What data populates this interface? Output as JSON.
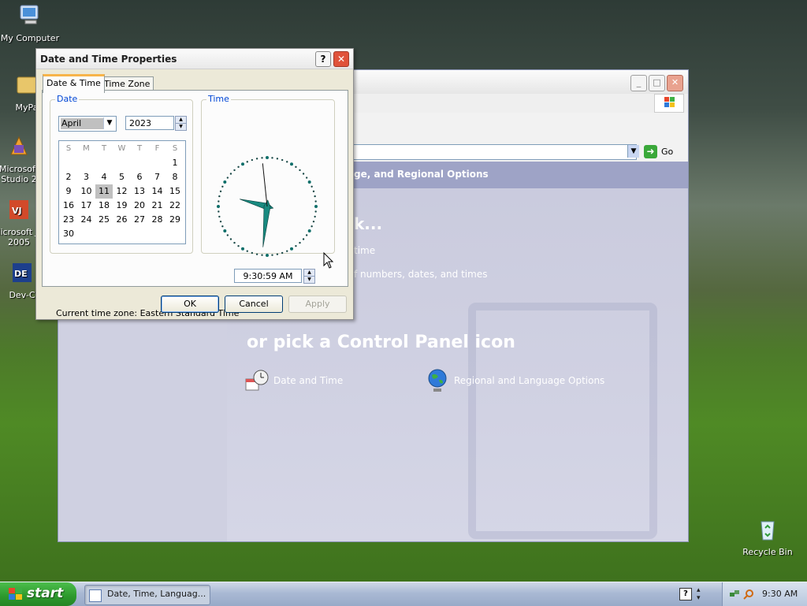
{
  "desktop": {
    "icons": [
      {
        "label": "My Computer"
      },
      {
        "label": "MyPa"
      },
      {
        "label": "Microsoft Studio 2"
      },
      {
        "label": "Microsoft J# 2005"
      },
      {
        "label": "Dev-C"
      },
      {
        "label": "Recycle Bin"
      }
    ]
  },
  "control_panel": {
    "go_label": "Go",
    "header": "ge, and Regional Options",
    "pick_task": "k...",
    "task1": "time",
    "task2": "f numbers, dates, and times",
    "pick_icon": "or pick a Control Panel icon",
    "icon_date_time": "Date and Time",
    "icon_regional": "Regional and Language Options"
  },
  "dialog": {
    "title": "Date and Time Properties",
    "help": "?",
    "close": "✕",
    "tabs": [
      "Date & Time",
      "Time Zone"
    ],
    "date_group": "Date",
    "time_group": "Time",
    "month": "April",
    "year": "2023",
    "weekdays": [
      "S",
      "M",
      "T",
      "W",
      "T",
      "F",
      "S"
    ],
    "calendar_days": [
      [
        "",
        "",
        "",
        "",
        "",
        "",
        "1"
      ],
      [
        "2",
        "3",
        "4",
        "5",
        "6",
        "7",
        "8"
      ],
      [
        "9",
        "10",
        "11",
        "12",
        "13",
        "14",
        "15"
      ],
      [
        "16",
        "17",
        "18",
        "19",
        "20",
        "21",
        "22"
      ],
      [
        "23",
        "24",
        "25",
        "26",
        "27",
        "28",
        "29"
      ],
      [
        "30",
        "",
        "",
        "",
        "",
        "",
        ""
      ]
    ],
    "selected_day": "11",
    "time": "9:30:59 AM",
    "clock": {
      "hour": 9,
      "minute": 30,
      "second": 59
    },
    "timezone_text": "Current time zone:  Eastern Standard Time",
    "buttons": {
      "ok": "OK",
      "cancel": "Cancel",
      "apply": "Apply"
    }
  },
  "taskbar": {
    "start_label": "start",
    "task_label": "Date, Time, Languag...",
    "clock": "9:30 AM"
  }
}
